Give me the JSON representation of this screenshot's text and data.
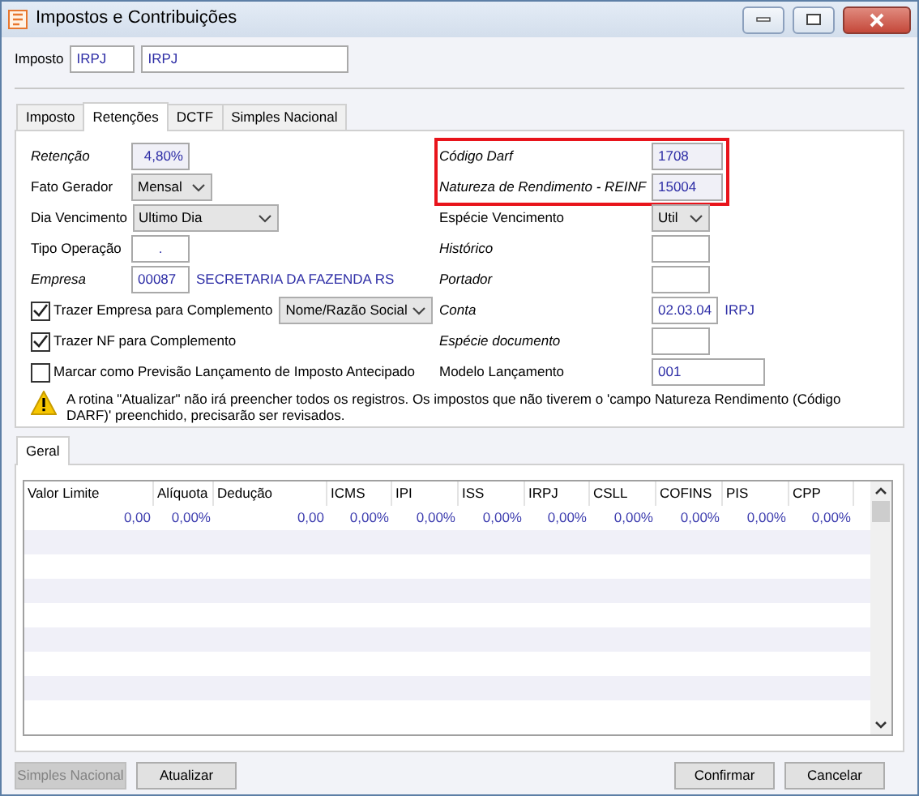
{
  "window": {
    "title": "Impostos e Contribuições"
  },
  "imposto": {
    "label": "Imposto",
    "code": "IRPJ",
    "name": "IRPJ"
  },
  "tabs": [
    {
      "label": "Imposto",
      "selected": false
    },
    {
      "label": "Retenções",
      "selected": true
    },
    {
      "label": "DCTF",
      "selected": false
    },
    {
      "label": "Simples Nacional",
      "selected": false
    }
  ],
  "left_fields": [
    {
      "kind": "input",
      "label": "Retenção",
      "italic": true,
      "value": "4,80%",
      "readonly": true
    },
    {
      "kind": "select",
      "label": "Fato Gerador",
      "italic": false,
      "value": "Mensal"
    },
    {
      "kind": "select",
      "label": "Dia Vencimento",
      "italic": false,
      "value": "Ultimo Dia"
    },
    {
      "kind": "input",
      "label": "Tipo Operação",
      "italic": false,
      "value": ".",
      "readonly": false
    },
    {
      "kind": "input",
      "label": "Empresa",
      "italic": true,
      "value": "00087",
      "readonly": false,
      "extra": "SECRETARIA DA FAZENDA RS"
    },
    {
      "kind": "checkbox",
      "label": "Trazer Empresa para Complemento",
      "checked": true,
      "select": "Nome/Razão Social"
    },
    {
      "kind": "checkbox",
      "label": "Trazer NF para Complemento",
      "checked": true
    },
    {
      "kind": "checkbox",
      "label": "Marcar como Previsão Lançamento de Imposto Antecipado",
      "checked": false
    }
  ],
  "right_fields": [
    {
      "kind": "input",
      "label": "Código Darf",
      "italic": true,
      "value": "1708",
      "readonly": true,
      "highlighted": true
    },
    {
      "kind": "input",
      "label": "Natureza de Rendimento - REINF",
      "italic": true,
      "value": "15004",
      "readonly": true,
      "highlighted": true
    },
    {
      "kind": "select",
      "label": "Espécie Vencimento",
      "italic": false,
      "value": "Util",
      "highlighted": false
    },
    {
      "kind": "input",
      "label": "Histórico",
      "italic": true,
      "readonly": false,
      "highlighted": false
    },
    {
      "kind": "input",
      "label": "Portador",
      "italic": true,
      "readonly": false,
      "highlighted": false
    },
    {
      "kind": "input",
      "label": "Conta",
      "italic": true,
      "value": "02.03.04",
      "readonly": false,
      "highlighted": false,
      "extra": "IRPJ"
    },
    {
      "kind": "input",
      "label": "Espécie documento",
      "italic": true,
      "readonly": false,
      "highlighted": false
    },
    {
      "kind": "input",
      "label": "Modelo Lançamento",
      "italic": false,
      "value": "001",
      "readonly": false,
      "highlighted": false
    }
  ],
  "warning": "A rotina \"Atualizar\" não irá preencher todos os registros. Os impostos que não tiverem o 'campo Natureza Rendimento (Código DARF)' preenchido, precisarão ser revisados.",
  "lower_tabs": [
    {
      "label": "Geral",
      "selected": true
    }
  ],
  "table": {
    "columns": [
      "Valor Limite",
      "Alíquota",
      "Dedução",
      "ICMS",
      "IPI",
      "ISS",
      "IRPJ",
      "CSLL",
      "COFINS",
      "PIS",
      "CPP"
    ],
    "rows": [
      [
        "0,00",
        "0,00%",
        "0,00",
        "0,00%",
        "0,00%",
        "0,00%",
        "0,00%",
        "0,00%",
        "0,00%",
        "0,00%",
        "0,00%"
      ]
    ]
  },
  "buttons": [
    {
      "label": "Simples Nacional",
      "disabled": true
    },
    {
      "label": "Atualizar",
      "disabled": false
    },
    {
      "label": "Confirmar",
      "disabled": false
    },
    {
      "label": "Cancelar",
      "disabled": false
    }
  ]
}
